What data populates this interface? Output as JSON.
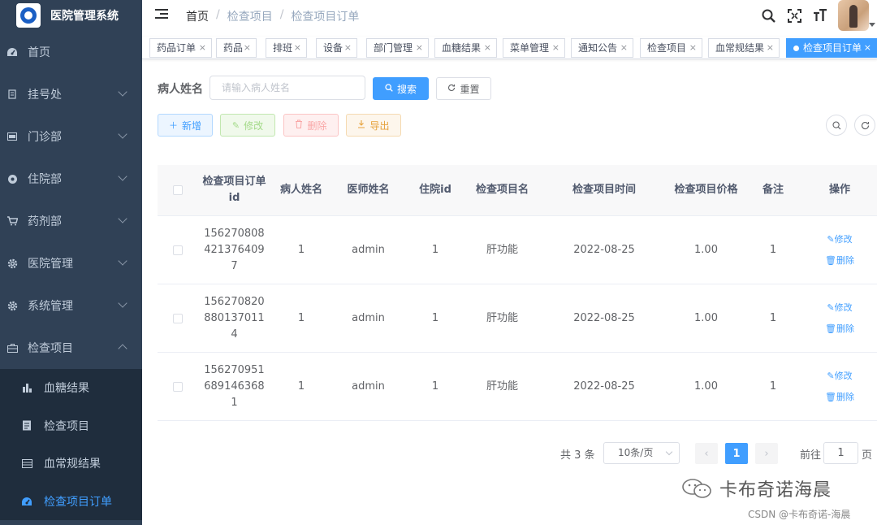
{
  "app": {
    "title": "医院管理系统"
  },
  "sidebar": {
    "items": [
      {
        "label": "首页",
        "icon": "dashboard-icon",
        "expandable": false
      },
      {
        "label": "挂号处",
        "icon": "register-icon",
        "expandable": true
      },
      {
        "label": "门诊部",
        "icon": "clinic-icon",
        "expandable": true
      },
      {
        "label": "住院部",
        "icon": "inpatient-icon",
        "expandable": true
      },
      {
        "label": "药剂部",
        "icon": "cart-icon",
        "expandable": true
      },
      {
        "label": "医院管理",
        "icon": "gear-icon",
        "expandable": true
      },
      {
        "label": "系统管理",
        "icon": "gear-icon",
        "expandable": true
      },
      {
        "label": "检查项目",
        "icon": "briefcase-icon",
        "expandable": true,
        "expanded": true
      }
    ],
    "sub_items": [
      {
        "label": "血糖结果",
        "icon": "bar-chart-icon"
      },
      {
        "label": "检查项目",
        "icon": "document-icon"
      },
      {
        "label": "血常规结果",
        "icon": "table-icon"
      },
      {
        "label": "检查项目订单",
        "icon": "dashboard-icon",
        "active": true
      }
    ]
  },
  "breadcrumb": {
    "home": "首页",
    "parent": "检查项目",
    "current": "检查项目订单"
  },
  "tags": [
    "药品订单",
    "药品",
    "排班",
    "设备",
    "部门管理",
    "血糖结果",
    "菜单管理",
    "通知公告",
    "检查项目",
    "血常规结果",
    "检查项目订单"
  ],
  "search": {
    "label": "病人姓名",
    "placeholder": "请输入病人姓名",
    "value": "",
    "search_label": "搜索",
    "reset_label": "重置"
  },
  "toolbar": {
    "add_label": "新增",
    "edit_label": "修改",
    "delete_label": "删除",
    "export_label": "导出"
  },
  "table": {
    "headers": [
      "检查项目订单id",
      "病人姓名",
      "医师姓名",
      "住院id",
      "检查项目名",
      "检查项目时间",
      "检查项目价格",
      "备注",
      "操作"
    ],
    "rows": [
      {
        "id_lines": [
          "156270808",
          "421376409",
          "7"
        ],
        "patient": "1",
        "doctor": "admin",
        "admission_id": "1",
        "item_name": "肝功能",
        "time": "2022-08-25",
        "price": "1.00",
        "remark": "1"
      },
      {
        "id_lines": [
          "156270820",
          "880137011",
          "4"
        ],
        "patient": "1",
        "doctor": "admin",
        "admission_id": "1",
        "item_name": "肝功能",
        "time": "2022-08-25",
        "price": "1.00",
        "remark": "1"
      },
      {
        "id_lines": [
          "156270951",
          "689146368",
          "1"
        ],
        "patient": "1",
        "doctor": "admin",
        "admission_id": "1",
        "item_name": "肝功能",
        "time": "2022-08-25",
        "price": "1.00",
        "remark": "1"
      }
    ],
    "row_actions": {
      "edit": "修改",
      "delete": "删除"
    }
  },
  "pagination": {
    "total": "共 3 条",
    "page_size": "10条/页",
    "current_page": "1",
    "goto_label": "前往",
    "goto_value": "1",
    "page_unit": "页"
  },
  "watermark": {
    "line1": "卡布奇诺海晨",
    "line2": "CSDN @卡布奇诺-海晨"
  },
  "colors": {
    "sidebar_bg": "#304156",
    "submenu_bg": "#1f2d3d",
    "primary": "#409eff"
  }
}
